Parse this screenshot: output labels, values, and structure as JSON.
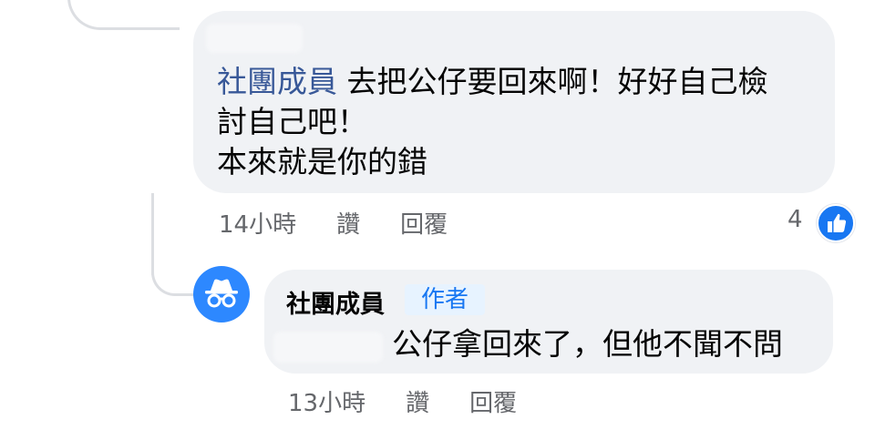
{
  "comment": {
    "mention": "社團成員",
    "text_line1": "去把公仔要回來啊！好好自己檢",
    "text_line2": "討自己吧！",
    "text_line3": "本來就是你的錯",
    "time": "14小時",
    "like_label": "讚",
    "reply_label": "回覆",
    "reaction_count": "4",
    "reaction_icon": "like-thumb-icon"
  },
  "reply": {
    "author": "社團成員",
    "badge": "作者",
    "text": "公仔拿回來了，但他不聞不問",
    "time": "13小時",
    "like_label": "讚",
    "reply_label": "回覆",
    "avatar_icon": "incognito-icon"
  },
  "colors": {
    "accent": "#1877f2",
    "mention": "#385898",
    "bubble": "#f0f2f5",
    "badge_bg": "#e7f3ff",
    "secondary_text": "#65676b"
  }
}
